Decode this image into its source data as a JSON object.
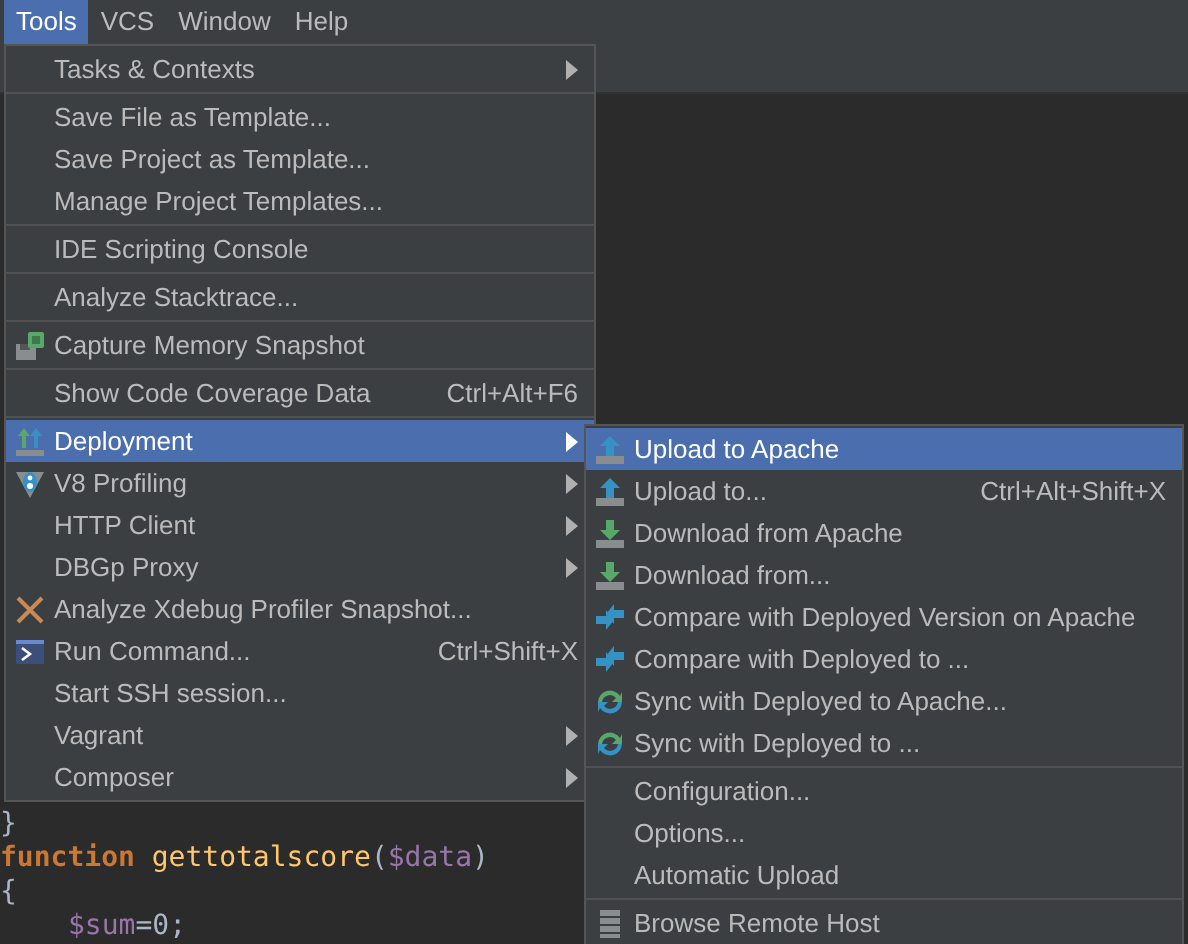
{
  "menubar": [
    {
      "label": "Tools",
      "selected": true
    },
    {
      "label": "VCS",
      "selected": false
    },
    {
      "label": "Window",
      "selected": false
    },
    {
      "label": "Help",
      "selected": false
    }
  ],
  "tools_menu": {
    "groups": [
      [
        {
          "label": "Tasks & Contexts",
          "submenu": true,
          "selected": false
        }
      ],
      [
        {
          "label": "Save File as Template...",
          "submenu": false,
          "selected": false
        },
        {
          "label": "Save Project as Template...",
          "submenu": false,
          "selected": false
        },
        {
          "label": "Manage Project Templates...",
          "submenu": false,
          "selected": false
        }
      ],
      [
        {
          "label": "IDE Scripting Console",
          "submenu": false,
          "selected": false
        }
      ],
      [
        {
          "label": "Analyze Stacktrace...",
          "submenu": false,
          "selected": false
        }
      ],
      [
        {
          "label": "Capture Memory Snapshot",
          "kind": "memory",
          "submenu": false,
          "selected": false
        }
      ],
      [
        {
          "label": "Show Code Coverage Data",
          "shortcut": "Ctrl+Alt+F6",
          "submenu": false,
          "selected": false
        }
      ],
      [
        {
          "label": "Deployment",
          "kind": "deploy",
          "submenu": true,
          "selected": true
        },
        {
          "label": "V8 Profiling",
          "kind": "v8",
          "submenu": true,
          "selected": false
        },
        {
          "label": "HTTP Client",
          "submenu": true,
          "selected": false
        },
        {
          "label": "DBGp Proxy",
          "submenu": true,
          "selected": false
        },
        {
          "label": "Analyze Xdebug Profiler Snapshot...",
          "kind": "xdebug",
          "submenu": false,
          "selected": false
        },
        {
          "label": "Run Command...",
          "kind": "console",
          "shortcut": "Ctrl+Shift+X",
          "submenu": false,
          "selected": false
        },
        {
          "label": "Start SSH session...",
          "submenu": false,
          "selected": false
        },
        {
          "label": "Vagrant",
          "submenu": true,
          "selected": false
        },
        {
          "label": "Composer",
          "submenu": true,
          "selected": false
        }
      ]
    ]
  },
  "deployment_menu": {
    "groups": [
      [
        {
          "label": "Upload to Apache",
          "kind": "upload",
          "submenu": false,
          "selected": true
        },
        {
          "label": "Upload to...",
          "kind": "upload",
          "shortcut": "Ctrl+Alt+Shift+X",
          "submenu": false,
          "selected": false
        },
        {
          "label": "Download from Apache",
          "kind": "download",
          "submenu": false,
          "selected": false
        },
        {
          "label": "Download from...",
          "kind": "download",
          "submenu": false,
          "selected": false
        },
        {
          "label": "Compare with Deployed Version on Apache",
          "kind": "compare",
          "submenu": false,
          "selected": false
        },
        {
          "label": "Compare with Deployed to ...",
          "kind": "compare",
          "submenu": false,
          "selected": false
        },
        {
          "label": "Sync with Deployed to Apache...",
          "kind": "sync",
          "submenu": false,
          "selected": false
        },
        {
          "label": "Sync with Deployed to ...",
          "kind": "sync",
          "submenu": false,
          "selected": false
        }
      ],
      [
        {
          "label": "Configuration...",
          "submenu": false,
          "selected": false
        },
        {
          "label": "Options...",
          "submenu": false,
          "selected": false
        },
        {
          "label": "Automatic Upload",
          "submenu": false,
          "selected": false
        }
      ],
      [
        {
          "label": "Browse Remote Host",
          "kind": "server",
          "submenu": false,
          "selected": false
        }
      ]
    ]
  },
  "editor": {
    "lines": [
      {
        "indent": false,
        "tokens": [
          {
            "kind": "punct",
            "text": "}"
          }
        ]
      },
      {
        "indent": false,
        "tokens": [
          {
            "kind": "keyword",
            "text": "function"
          },
          {
            "kind": "funcname",
            "text": "gettotalscore"
          },
          {
            "kind": "punct",
            "text": "("
          },
          {
            "kind": "variable",
            "text": "$data"
          },
          {
            "kind": "punct",
            "text": ")"
          }
        ]
      },
      {
        "indent": false,
        "tokens": [
          {
            "kind": "punct",
            "text": "{"
          }
        ]
      },
      {
        "indent": true,
        "tokens": [
          {
            "kind": "variable",
            "text": "$sum"
          },
          {
            "kind": "punct",
            "text": "=0;"
          }
        ]
      }
    ]
  }
}
